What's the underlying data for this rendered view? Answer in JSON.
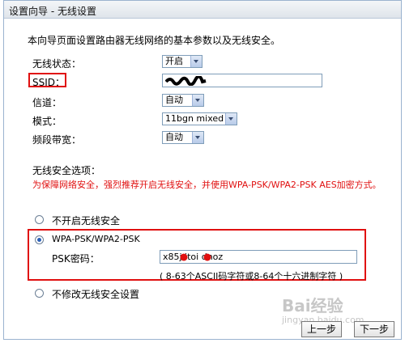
{
  "window": {
    "title": "设置向导 - 无线设置"
  },
  "intro_text": "本向导页面设置路由器无线网络的基本参数以及无线安全。",
  "form": {
    "wireless_status": {
      "label": "无线状态：",
      "value": "开启"
    },
    "ssid": {
      "label": "SSID：",
      "value": ""
    },
    "channel": {
      "label": "信道：",
      "value": "自动"
    },
    "mode": {
      "label": "模式：",
      "value": "11bgn mixed"
    },
    "bandwidth": {
      "label": "频段带宽：",
      "value": "自动"
    }
  },
  "security": {
    "title": "无线安全选项：",
    "warning": "为保障网络安全，强烈推荐开启无线安全，并使用WPA-PSK/WPA2-PSK AES加密方式。",
    "options": [
      {
        "label": "不开启无线安全",
        "checked": false
      },
      {
        "label": "WPA-PSK/WPA2-PSK",
        "checked": true
      },
      {
        "label": "不修改无线安全设置",
        "checked": false
      }
    ],
    "psk_label": "PSK密码：",
    "psk_value": "x85j itoi dnoz",
    "psk_hint": "( 8-63个ASCII码字符或8-64个十六进制字符 )"
  },
  "buttons": {
    "prev": "上一步",
    "next": "下一步"
  },
  "watermark": {
    "text": "Bai经验",
    "sub": "jingyan.baidu.com"
  },
  "colors": {
    "highlight": "#e01010",
    "warning": "#e01010",
    "title_bg": "#dfe4ea"
  }
}
